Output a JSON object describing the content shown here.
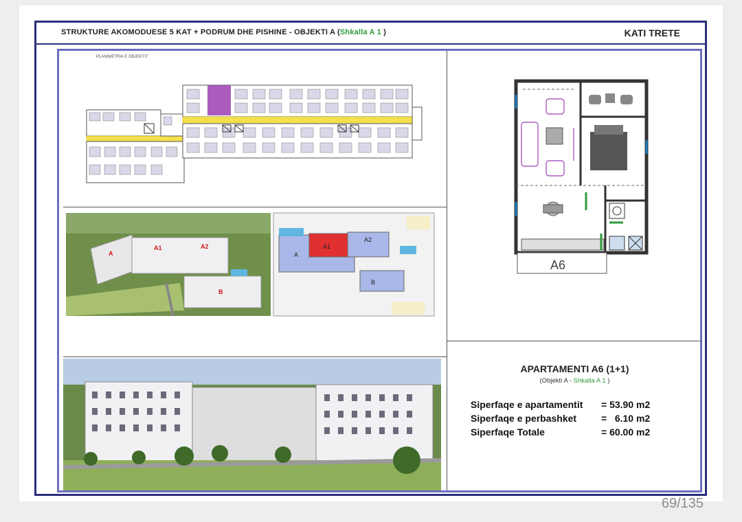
{
  "header": {
    "title_main": "STRUKTURE AKOMODUESE 5 KAT + PODRUM DHE PISHINE",
    "title_sep": "  -  OBJEKTI A (",
    "title_green": "Shkalla A 1",
    "title_close": " )",
    "floor": "KATI TRETE"
  },
  "plan": {
    "label": "PLANIMETRIA E OBJEKTIT"
  },
  "site": {
    "aerial_labels": [
      "A",
      "A1",
      "A2",
      "B"
    ],
    "plan_labels": [
      "A",
      "A1",
      "A2",
      "B"
    ]
  },
  "apartment_plan": {
    "label": "A6"
  },
  "info": {
    "title": "APARTAMENTI A6 (1+1)",
    "subtitle_prefix": "(Objekti A - ",
    "subtitle_green": "Shkalla A 1",
    "subtitle_suffix": " )",
    "rows": [
      {
        "label": "Siperfaqe e apartamentit",
        "value": "= 53.90 m2"
      },
      {
        "label": "Siperfaqe e perbashket",
        "value": "=   6.10 m2"
      },
      {
        "label": "Siperfaqe Totale",
        "value": "= 60.00 m2"
      }
    ]
  },
  "footer": {
    "page": "69/135"
  },
  "colors": {
    "frame": "#2a2f7a",
    "inner_frame": "#6a6fc0",
    "accent_green": "#2e9b3a",
    "corridor_yellow": "#f4e04d",
    "highlight_purple": "#9b3fb0",
    "building_red": "#e03030",
    "building_blue": "#a9b8e8"
  }
}
